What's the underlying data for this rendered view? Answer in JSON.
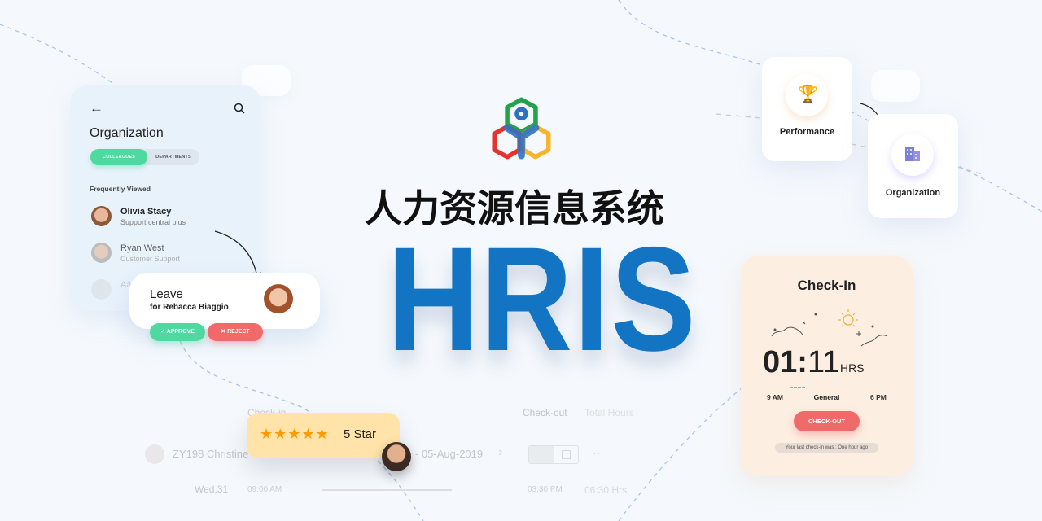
{
  "brand": {
    "title_cn": "人力资源信息系统",
    "title_en": "HRIS",
    "logo": "hexagon-person-logo",
    "accent": "#1474c4"
  },
  "org_panel": {
    "title": "Organization",
    "tabs": [
      {
        "label": "COLLEAGUES",
        "active": true
      },
      {
        "label": "DEPARTMENTS",
        "active": false
      }
    ],
    "section": "Frequently Viewed",
    "people": [
      {
        "name": "Olivia Stacy",
        "role": "Support central plus"
      },
      {
        "name": "Ryan West",
        "role": "Customer Support"
      },
      {
        "name": "Aa",
        "role": ""
      }
    ]
  },
  "leave_card": {
    "title": "Leave",
    "subtitle": "for Rebacca Biaggio",
    "approve": "APPROVE",
    "reject": "REJECT"
  },
  "modules": [
    {
      "label": "Performance",
      "icon": "trophy-icon"
    },
    {
      "label": "Organization",
      "icon": "building-icon"
    }
  ],
  "checkin": {
    "title": "Check-In",
    "hours": "01",
    "minutes": "11",
    "unit": "HRS",
    "start": "9 AM",
    "shift": "General",
    "end": "6 PM",
    "button": "CHECK-OUT",
    "note": "Your last check-in was : One hour ago"
  },
  "attendance": {
    "headers": {
      "checkin": "Check-in",
      "checkout": "Check-out",
      "total": "Total Hours"
    },
    "employee": "ZY198 Christine",
    "date": "- 05-Aug-2019",
    "day": "Wed,31",
    "in_time": "09:00 AM",
    "out_time": "03:30 PM",
    "total": "06:30 Hrs"
  },
  "rating": {
    "stars": 5,
    "label": "5 Star",
    "color": "#ff9a00"
  }
}
